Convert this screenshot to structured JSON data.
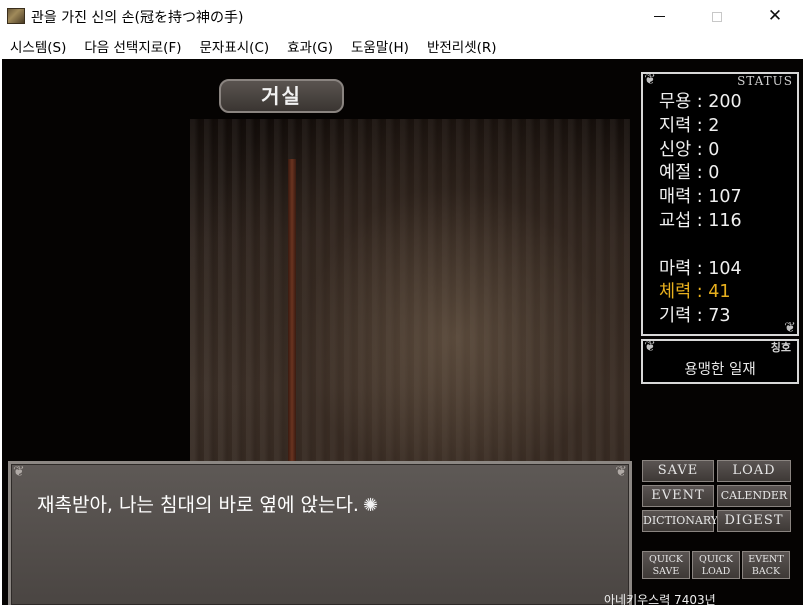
{
  "window": {
    "title": "관을 가진 신의 손(冠を持つ神の手)",
    "min_glyph": "",
    "close_glyph": "✕"
  },
  "menu": [
    {
      "label": "시스템(S)"
    },
    {
      "label": "다음 선택지로(F)"
    },
    {
      "label": "문자표시(C)"
    },
    {
      "label": "효과(G)"
    },
    {
      "label": "도움말(H)"
    },
    {
      "label": "반전리셋(R)"
    }
  ],
  "scene": {
    "location": "거실"
  },
  "status": {
    "header": "STATUS",
    "stats": [
      {
        "label": "무용 : 200"
      },
      {
        "label": "지력 : 2"
      },
      {
        "label": "신앙 : 0"
      },
      {
        "label": "예절 : 0"
      },
      {
        "label": "매력 : 107"
      },
      {
        "label": "교섭 : 116"
      },
      {
        "label": "마력 : 104"
      },
      {
        "label": "체력 : 41",
        "highlight_color": "#e8b01e"
      },
      {
        "label": "기력 : 73"
      }
    ]
  },
  "title_box": {
    "header": "칭호",
    "value": "용맹한 일재"
  },
  "dialogue": {
    "text": "재촉받아, 나는 침대의 바로 옆에 앉는다.",
    "next_icon": "✺"
  },
  "buttons": {
    "save": "SAVE",
    "load": "LOAD",
    "event": "EVENT",
    "calender": "CALENDER",
    "dictionary": "DICTIONARY",
    "digest": "DIGEST",
    "quick_save": [
      "QUICK",
      "SAVE"
    ],
    "quick_load": [
      "QUICK",
      "LOAD"
    ],
    "event_back": [
      "EVENT",
      "BACK"
    ]
  },
  "footer": {
    "text": "아네키우스력 7403년"
  }
}
